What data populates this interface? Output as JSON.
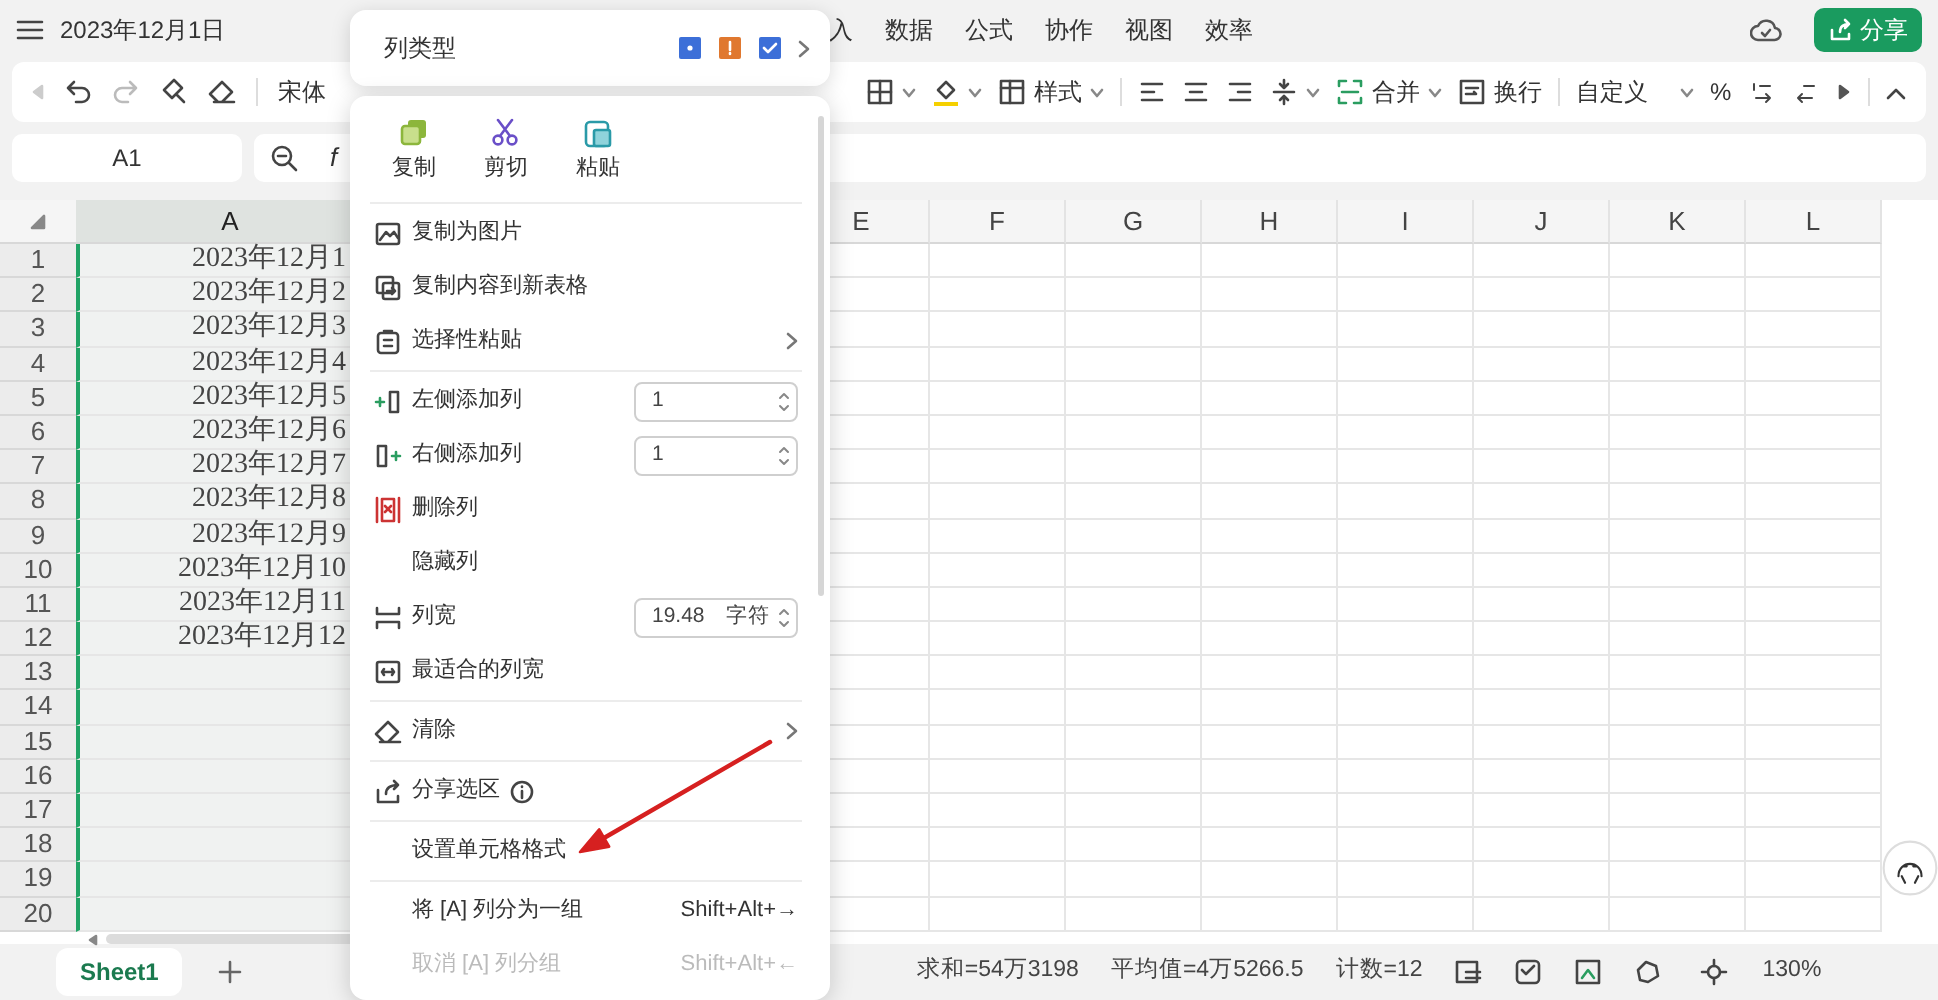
{
  "title_bar": {
    "title": "2023年12月1日",
    "menu_tabs": [
      "入",
      "数据",
      "公式",
      "协作",
      "视图",
      "效率"
    ],
    "share_button": "分享"
  },
  "toolbar": {
    "font": "宋体",
    "style": "样式",
    "merge": "合并",
    "wrap": "换行",
    "number_format": "自定义",
    "percent": "%"
  },
  "formula_bar": {
    "cell_ref": "A1",
    "formula_label": "f"
  },
  "sheet": {
    "columns": [
      {
        "label": "A",
        "selected": true
      },
      {
        "label": "E",
        "selected": false
      },
      {
        "label": "F",
        "selected": false
      },
      {
        "label": "G",
        "selected": false
      },
      {
        "label": "H",
        "selected": false
      },
      {
        "label": "I",
        "selected": false
      },
      {
        "label": "J",
        "selected": false
      },
      {
        "label": "K",
        "selected": false
      },
      {
        "label": "L",
        "selected": false
      }
    ],
    "rows": [
      {
        "number": "1",
        "cell_a": "2023年12月1"
      },
      {
        "number": "2",
        "cell_a": "2023年12月2"
      },
      {
        "number": "3",
        "cell_a": "2023年12月3"
      },
      {
        "number": "4",
        "cell_a": "2023年12月4"
      },
      {
        "number": "5",
        "cell_a": "2023年12月5"
      },
      {
        "number": "6",
        "cell_a": "2023年12月6"
      },
      {
        "number": "7",
        "cell_a": "2023年12月7"
      },
      {
        "number": "8",
        "cell_a": "2023年12月8"
      },
      {
        "number": "9",
        "cell_a": "2023年12月9"
      },
      {
        "number": "10",
        "cell_a": "2023年12月10"
      },
      {
        "number": "11",
        "cell_a": "2023年12月11"
      },
      {
        "number": "12",
        "cell_a": "2023年12月12"
      },
      {
        "number": "13"
      },
      {
        "number": "14"
      },
      {
        "number": "15"
      },
      {
        "number": "16"
      },
      {
        "number": "17"
      },
      {
        "number": "18"
      },
      {
        "number": "19"
      },
      {
        "number": "20"
      }
    ]
  },
  "context_menu": {
    "column_type": "列类型",
    "clipboard": [
      {
        "kind": "copy",
        "label": "复制"
      },
      {
        "kind": "cut",
        "label": "剪切"
      },
      {
        "kind": "paste",
        "label": "粘贴"
      }
    ],
    "sections": [
      [
        {
          "label": "复制为图片",
          "kind": "plain",
          "disabled": false
        },
        {
          "label": "复制内容到新表格",
          "kind": "plain",
          "disabled": false
        },
        {
          "label": "选择性粘贴",
          "kind": "submenu",
          "disabled": false
        }
      ],
      [
        {
          "label": "左侧添加列",
          "kind": "spinner",
          "value": "1",
          "disabled": false
        },
        {
          "label": "右侧添加列",
          "kind": "spinner",
          "value": "1",
          "disabled": false
        },
        {
          "label": "删除列",
          "kind": "plain",
          "disabled": false
        },
        {
          "label": "隐藏列",
          "kind": "plain",
          "disabled": false
        },
        {
          "label": "列宽",
          "kind": "spinner",
          "value": "19.48",
          "unit": "字符",
          "disabled": false
        },
        {
          "label": "最适合的列宽",
          "kind": "plain",
          "disabled": false
        }
      ],
      [
        {
          "label": "清除",
          "kind": "submenu",
          "disabled": false
        }
      ],
      [
        {
          "label": "分享选区",
          "kind": "info",
          "disabled": false
        }
      ],
      [
        {
          "label": "设置单元格格式",
          "kind": "plain",
          "disabled": false
        }
      ],
      [
        {
          "label": "将 [A] 列分为一组",
          "kind": "shortcut",
          "shortcut": "Shift+Alt+→",
          "disabled": false
        },
        {
          "label": "取消 [A] 列分组",
          "kind": "shortcut",
          "shortcut": "Shift+Alt+←",
          "disabled": true
        }
      ]
    ]
  },
  "sheet_tabs": [
    {
      "label": "Sheet1",
      "selected": true
    }
  ],
  "status_bar": {
    "sum": "求和=54万3198",
    "average": "平均值=4万5266.5",
    "count": "计数=12",
    "zoom": "130%"
  }
}
